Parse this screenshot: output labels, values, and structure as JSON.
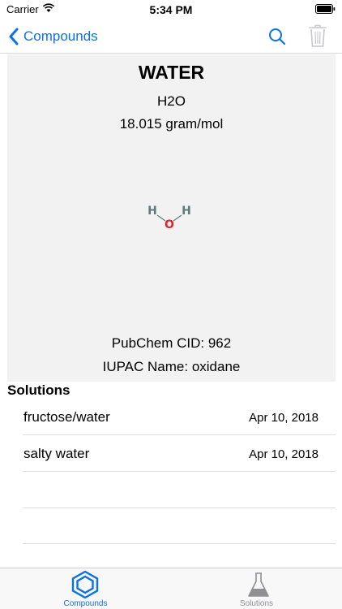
{
  "status_bar": {
    "carrier": "Carrier",
    "time": "5:34 PM"
  },
  "nav": {
    "back_label": "Compounds",
    "accent_color": "#0a72e8",
    "search_icon": "search-icon",
    "trash_icon": "trash-icon"
  },
  "compound": {
    "name": "WATER",
    "formula": "H2O",
    "molar_mass": "18.015 gram/mol",
    "structure": {
      "left_atom": "H",
      "center_atom": "O",
      "right_atom": "H"
    },
    "pubchem_cid": "PubChem CID: 962",
    "iupac_name": "IUPAC Name: oxidane"
  },
  "solutions": {
    "header": "Solutions",
    "items": [
      {
        "name": "fructose/water",
        "date": "Apr 10, 2018"
      },
      {
        "name": "salty water",
        "date": "Apr 10, 2018"
      }
    ]
  },
  "tab_bar": {
    "tabs": [
      {
        "label": "Compounds",
        "icon": "hexagon-icon",
        "selected": true
      },
      {
        "label": "Solutions",
        "icon": "flask-icon",
        "selected": false
      }
    ]
  }
}
